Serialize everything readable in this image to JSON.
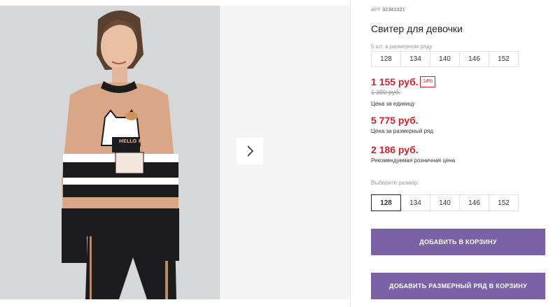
{
  "product": {
    "art_label": "АРТ",
    "art_number": "32341021",
    "title": "Свитер для девочки",
    "pack_note": "5 шт. в размерном ряду",
    "pack_sizes": [
      "128",
      "134",
      "140",
      "146",
      "152"
    ],
    "price": "1 155 руб.",
    "discount": "14%",
    "old_price": "1 350 руб.",
    "price_caption": "Цена за единицу",
    "set_price": "5 775 руб.",
    "set_caption": "Цена за размерный ряд",
    "rrp_price": "2 186 руб.",
    "rrp_caption": "Рекомендуемая розничная цена",
    "choose_label": "Выберите размер:",
    "sizes": [
      "128",
      "134",
      "140",
      "146",
      "152"
    ],
    "selected_size": "128"
  },
  "buttons": {
    "add_to_cart": "ДОБАВИТЬ В КОРЗИНУ",
    "add_set_to_cart": "ДОБАВИТЬ РАЗМЕРНЫЙ РЯД В КОРЗИНУ"
  },
  "gallery": {
    "next_icon": "chevron-right-icon",
    "photo_embroidery": "HELLO KITTY"
  },
  "colors": {
    "price_red": "#d51f2b",
    "button_purple": "#7b62a7"
  }
}
